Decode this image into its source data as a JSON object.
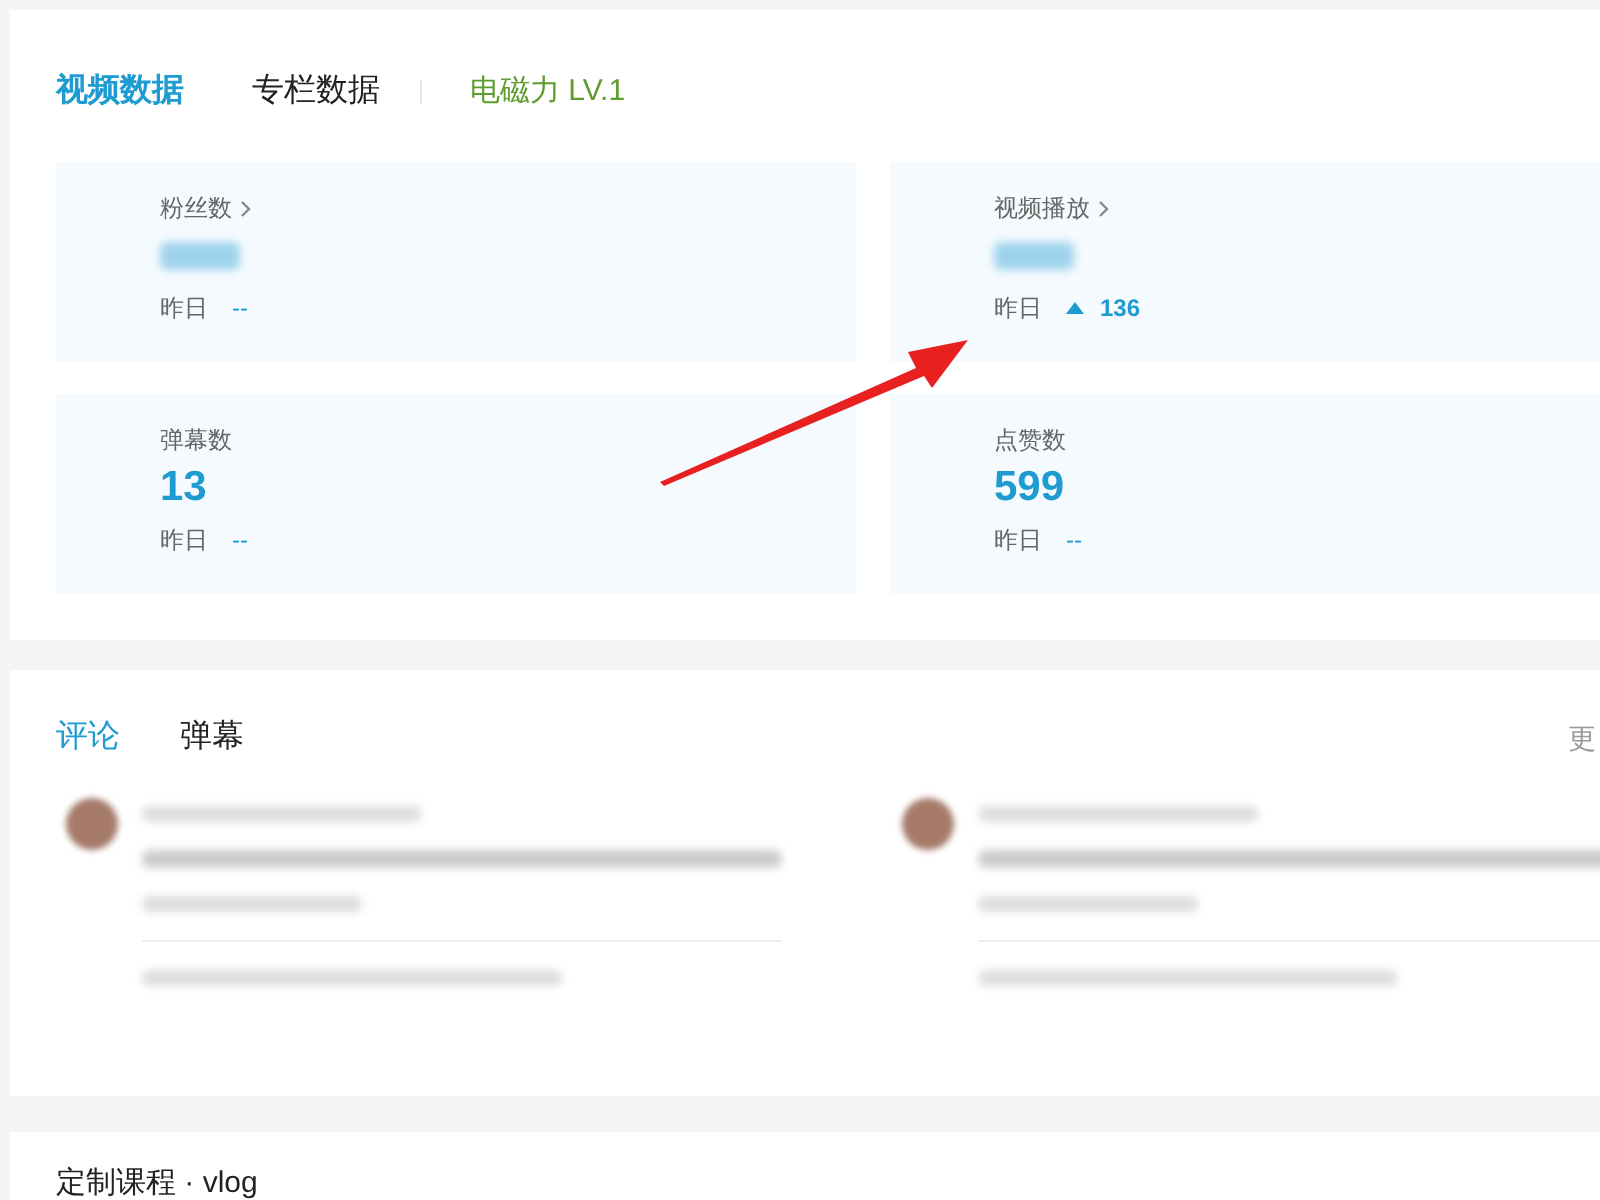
{
  "data_tabs": [
    {
      "label": "视频数据",
      "selected": true
    },
    {
      "label": "专栏数据",
      "selected": false
    }
  ],
  "level_badge": "电磁力 LV.1",
  "stats": [
    {
      "label": "粉丝数",
      "link": true,
      "yesterday_label": "昨日",
      "change": "--",
      "trend_up": false
    },
    {
      "label": "视频播放",
      "link": true,
      "yesterday_label": "昨日",
      "change": "136",
      "trend_up": true
    },
    {
      "label": "弹幕数",
      "link": false,
      "value": "13",
      "yesterday_label": "昨日",
      "change": "--",
      "trend_up": false
    },
    {
      "label": "点赞数",
      "link": false,
      "value": "599",
      "yesterday_label": "昨日",
      "change": "--",
      "trend_up": false
    }
  ],
  "feed_tabs": [
    {
      "label": "评论",
      "selected": true
    },
    {
      "label": "弹幕",
      "selected": false
    }
  ],
  "more_link": "更",
  "next_section_title": "定制课程 · vlog"
}
